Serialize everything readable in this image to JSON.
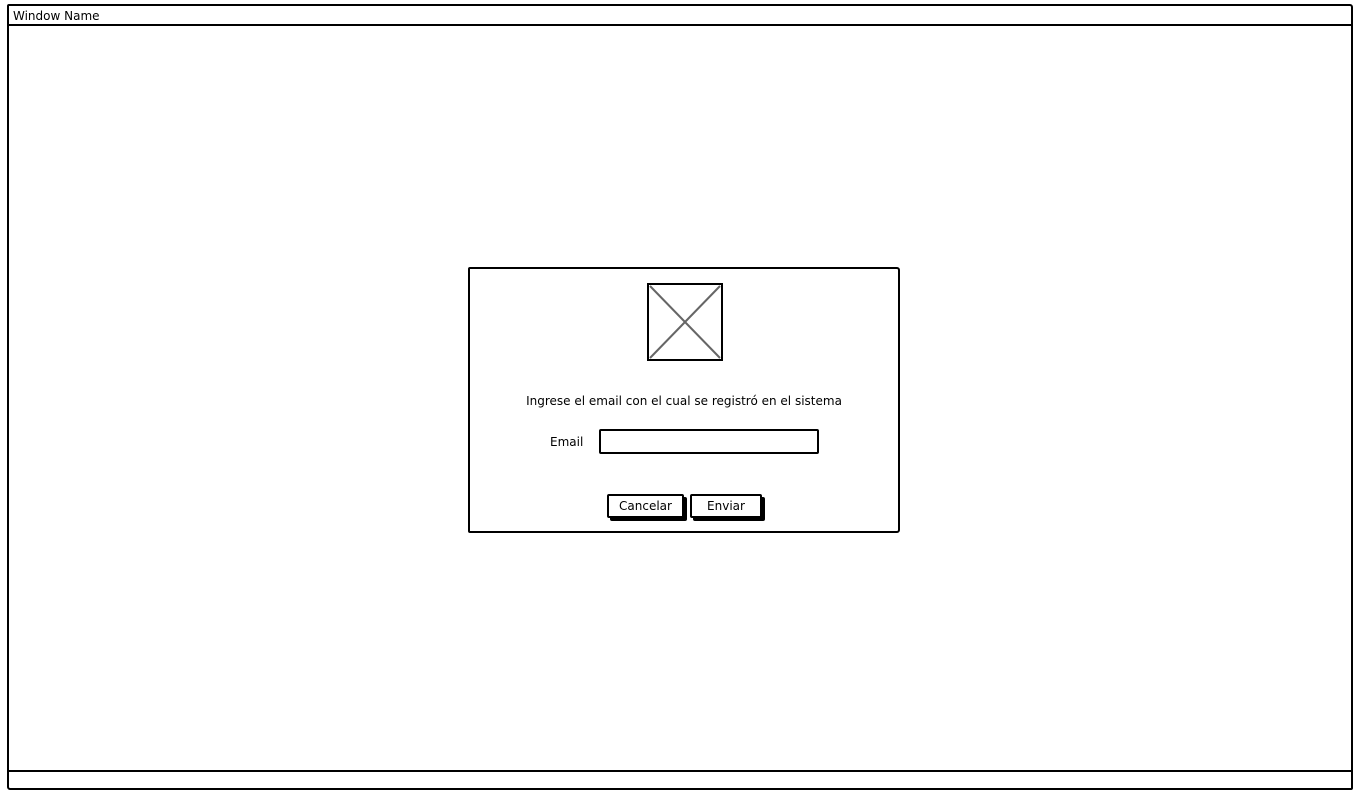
{
  "window": {
    "title": "Window Name"
  },
  "dialog": {
    "image_icon": "image-placeholder-icon",
    "instruction": "Ingrese el email con el cual se registró en el sistema",
    "email_label": "Email",
    "email_value": "",
    "email_placeholder": "",
    "cancel_label": "Cancelar",
    "send_label": "Enviar"
  }
}
